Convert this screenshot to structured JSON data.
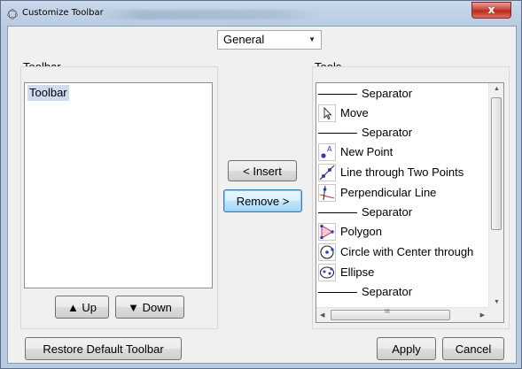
{
  "window": {
    "title": "Customize Toolbar",
    "close_label": "x"
  },
  "category": {
    "selected": "General"
  },
  "left_panel": {
    "label": "Toolbar",
    "items": [
      "Toolbar"
    ],
    "up_label": "▲ Up",
    "down_label": "▼ Down"
  },
  "middle": {
    "insert_label": "< Insert",
    "remove_label": "Remove >"
  },
  "right_panel": {
    "label": "Tools",
    "items": [
      {
        "type": "separator",
        "label": "Separator"
      },
      {
        "type": "tool",
        "label": "Move",
        "icon": "move-arrow-icon"
      },
      {
        "type": "separator",
        "label": "Separator"
      },
      {
        "type": "tool",
        "label": "New Point",
        "icon": "new-point-icon"
      },
      {
        "type": "tool",
        "label": "Line through Two Points",
        "icon": "line-icon"
      },
      {
        "type": "tool",
        "label": "Perpendicular Line",
        "icon": "perpendicular-line-icon"
      },
      {
        "type": "separator",
        "label": "Separator"
      },
      {
        "type": "tool",
        "label": "Polygon",
        "icon": "polygon-icon"
      },
      {
        "type": "tool",
        "label": "Circle with Center through",
        "icon": "circle-icon"
      },
      {
        "type": "tool",
        "label": "Ellipse",
        "icon": "ellipse-icon"
      },
      {
        "type": "separator",
        "label": "Separator"
      }
    ],
    "hscroll_grip": "III"
  },
  "footer": {
    "restore_label": "Restore Default Toolbar",
    "apply_label": "Apply",
    "cancel_label": "Cancel"
  }
}
